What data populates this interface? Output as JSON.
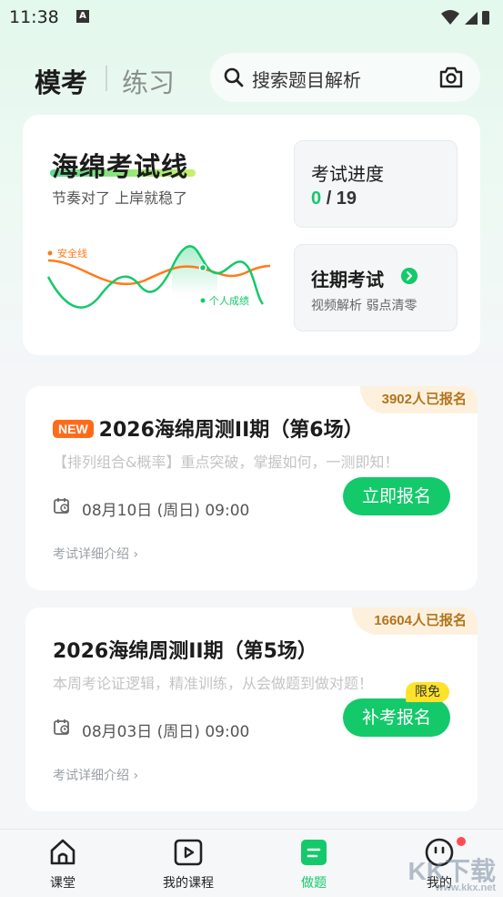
{
  "status_bar": {
    "time": "11:38",
    "notif_icon": "A"
  },
  "header": {
    "tabs": [
      {
        "label": "模考",
        "active": true
      },
      {
        "label": "练习",
        "active": false
      }
    ],
    "search": {
      "placeholder": "搜索题目解析"
    }
  },
  "hero": {
    "title": "海绵考试线",
    "subtitle": "节奏对了 上岸就稳了",
    "chart": {
      "legend_safe": "安全线",
      "legend_personal": "个人成绩"
    },
    "progress": {
      "label": "考试进度",
      "current": "0",
      "total": "/ 19"
    },
    "past": {
      "label": "往期考试",
      "subtitle": "视频解析 弱点清零"
    }
  },
  "exams": [
    {
      "badge": "3902人已报名",
      "new_tag": "NEW",
      "title": "2026海绵周测II期（第6场）",
      "desc": "【排列组合&概率】重点突破，掌握如何，一测即知！",
      "date": "08月10日 (周日) 09:00",
      "button": "立即报名",
      "more": "考试详细介绍 ›"
    },
    {
      "badge": "16604人已报名",
      "title": "2026海绵周测II期（第5场）",
      "desc": "本周考论证逻辑，精准训练，从会做题到做对题！",
      "date": "08月03日 (周日) 09:00",
      "button": "补考报名",
      "free_tag": "限免",
      "more": "考试详细介绍 ›"
    }
  ],
  "tabbar": {
    "items": [
      {
        "label": "课堂",
        "icon": "home-icon"
      },
      {
        "label": "我的课程",
        "icon": "play-icon"
      },
      {
        "label": "做题",
        "icon": "exercise-icon",
        "active": true
      },
      {
        "label": "我的",
        "icon": "profile-icon"
      }
    ]
  },
  "watermark": {
    "text": "KK下载",
    "url": "www.kkx.net"
  },
  "colors": {
    "accent": "#14c96a",
    "orange": "#ff6b1a",
    "badge_text": "#b3741e"
  }
}
